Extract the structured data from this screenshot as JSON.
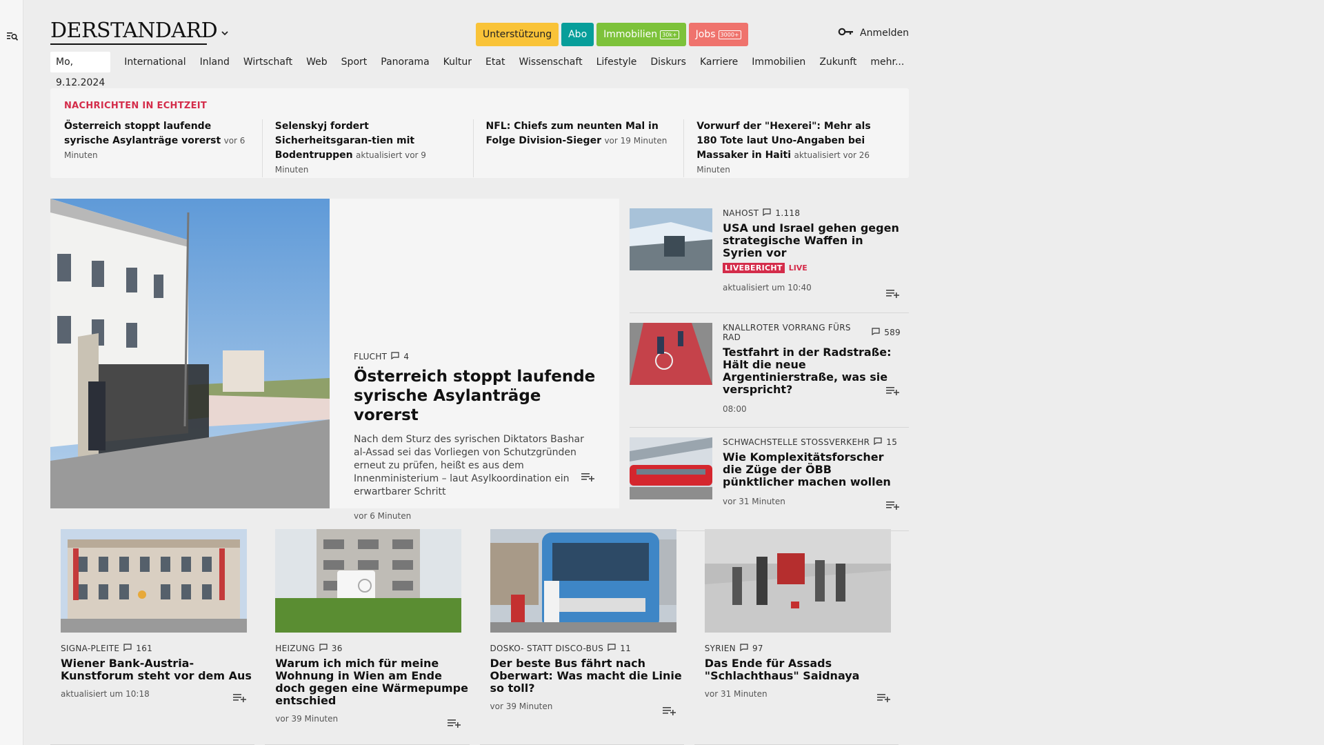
{
  "header": {
    "logo": "DERSTANDARD",
    "promo": [
      {
        "label": "Unterstützung",
        "badge": ""
      },
      {
        "label": "Abo",
        "badge": ""
      },
      {
        "label": "Immobilien",
        "badge": "30k+"
      },
      {
        "label": "Jobs",
        "badge": "3000+"
      }
    ],
    "login_label": "Anmelden"
  },
  "nav": {
    "date": "Mo, 9.12.2024",
    "links": [
      "International",
      "Inland",
      "Wirtschaft",
      "Web",
      "Sport",
      "Panorama",
      "Kultur",
      "Etat",
      "Wissenschaft",
      "Lifestyle",
      "Diskurs",
      "Karriere",
      "Immobilien",
      "Zukunft",
      "mehr..."
    ]
  },
  "ticker": {
    "title": "NACHRICHTEN IN ECHTZEIT",
    "items": [
      {
        "title": "Österreich stoppt laufende syrische Asylanträge vorerst",
        "time": "vor 6 Minuten"
      },
      {
        "title": "Selenskyj fordert Sicherheitsgaran-tien mit Bodentruppen",
        "time": "aktualisiert vor 9 Minuten"
      },
      {
        "title": "NFL: Chiefs zum neunten Mal in Folge Division-Sieger",
        "time": "vor 19 Minuten"
      },
      {
        "title": "Vorwurf der \"Hexerei\": Mehr als 180 Tote laut Uno-Angaben bei Massaker in Haiti",
        "time": "aktualisiert vor 26 Minuten"
      }
    ]
  },
  "lead": {
    "kicker": "FLUCHT",
    "comments": "4",
    "title": "Österreich stoppt laufende syrische Asylanträge vorerst",
    "teaser": "Nach dem Sturz des syrischen Diktators Bashar al-Assad sei das Vorliegen von Schutzgründen erneut zu prüfen, heißt es aus dem Innenministerium – laut Asylkoordination ein erwartbarer Schritt",
    "time": "vor 6 Minuten"
  },
  "side": [
    {
      "kicker": "NAHOST",
      "comments": "1.118",
      "title": "USA und Israel gehen gegen strategische Waffen in Syrien vor",
      "live_badge": "LIVEBERICHT",
      "live_text": "LIVE",
      "time": "aktualisiert um 10:40"
    },
    {
      "kicker": "KNALLROTER VORRANG FÜRS RAD",
      "comments": "589",
      "title": "Testfahrt in der Radstraße: Hält die neue Argentinierstraße, was sie verspricht?",
      "time": "08:00"
    },
    {
      "kicker": "SCHWACHSTELLE STOSSVERKEHR",
      "comments": "15",
      "title": "Wie Komplexitätsforscher die Züge der ÖBB pünktlicher machen wollen",
      "time": "vor 31 Minuten"
    }
  ],
  "cards": [
    {
      "kicker": "SIGNA-PLEITE",
      "comments": "161",
      "title": "Wiener Bank-Austria-Kunstforum steht vor dem Aus",
      "time": "aktualisiert um 10:18"
    },
    {
      "kicker": "HEIZUNG",
      "comments": "36",
      "title": "Warum ich mich für meine Wohnung in Wien am Ende doch gegen eine Wärmepumpe entschied",
      "time": "vor 39 Minuten"
    },
    {
      "kicker": "DOSKO- STATT DISCO-BUS",
      "comments": "11",
      "title": "Der beste Bus fährt nach Oberwart: Was macht die Linie so toll?",
      "time": "vor 39 Minuten"
    },
    {
      "kicker": "SYRIEN",
      "comments": "97",
      "title": "Das Ende für Assads \"Schlachthaus\" Saidnaya",
      "time": "vor 31 Minuten"
    }
  ],
  "colors": {
    "background": "#ededed",
    "accent_red": "#d42c4a",
    "promo_yellow": "#f9c338",
    "promo_teal": "#079e9a",
    "promo_green": "#7dc23a",
    "promo_red": "#ef736d"
  }
}
